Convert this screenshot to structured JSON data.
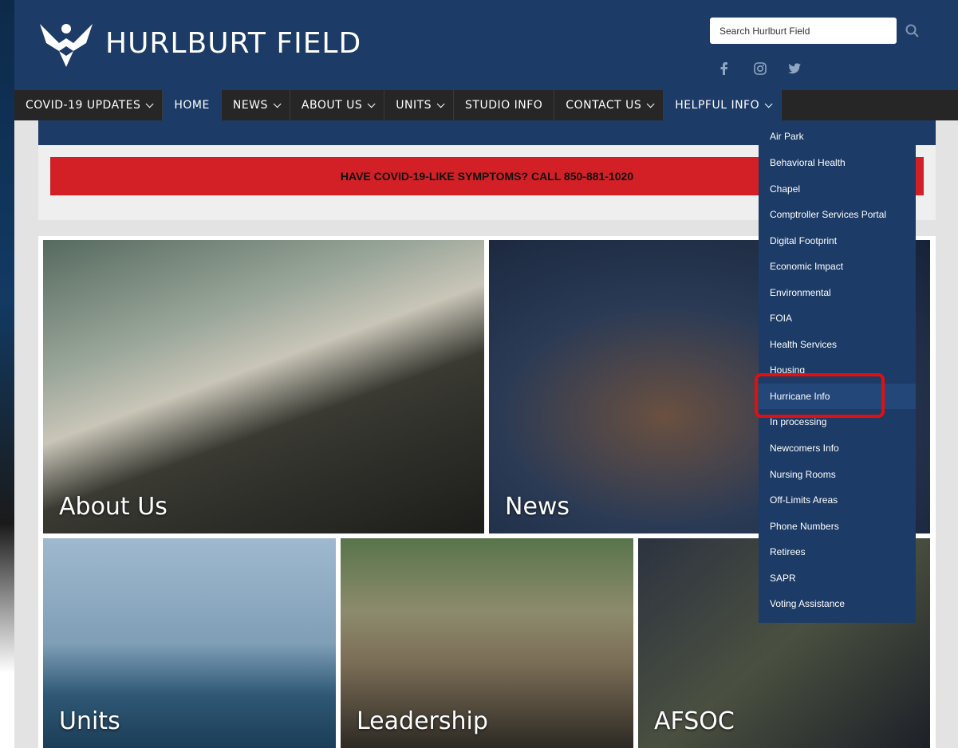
{
  "header": {
    "site_title": "HURLBURT FIELD",
    "search_placeholder": "Search Hurlburt Field",
    "social": [
      "facebook-icon",
      "instagram-icon",
      "twitter-icon"
    ]
  },
  "nav": [
    {
      "label": "COVID-19 UPDATES",
      "dropdown": true
    },
    {
      "label": "HOME",
      "dropdown": false
    },
    {
      "label": "NEWS",
      "dropdown": true
    },
    {
      "label": "ABOUT US",
      "dropdown": true
    },
    {
      "label": "UNITS",
      "dropdown": true
    },
    {
      "label": "STUDIO INFO",
      "dropdown": false
    },
    {
      "label": "CONTACT US",
      "dropdown": true
    },
    {
      "label": "HELPFUL INFO",
      "dropdown": true
    }
  ],
  "alert": "HAVE COVID-19-LIKE SYMPTOMS?  CALL 850-881-1020",
  "tiles": [
    "About Us",
    "News",
    "Units",
    "Leadership",
    "AFSOC"
  ],
  "helpful_info_menu": [
    "Air Park",
    "Behavioral Health",
    "Chapel",
    "Comptroller Services Portal",
    "Digital Footprint",
    "Economic Impact",
    "Environmental",
    "FOIA",
    "Health Services",
    "Housing",
    "Hurricane Info",
    "In processing",
    "Newcomers Info",
    "Nursing Rooms",
    "Off-Limits Areas",
    "Phone Numbers",
    "Retirees",
    "SAPR",
    "Voting Assistance"
  ],
  "highlighted_item": "Hurricane Info",
  "colors": {
    "header": "#1c3b66",
    "nav": "#262626",
    "alert": "#d31f26",
    "highlight": "#e01010"
  }
}
